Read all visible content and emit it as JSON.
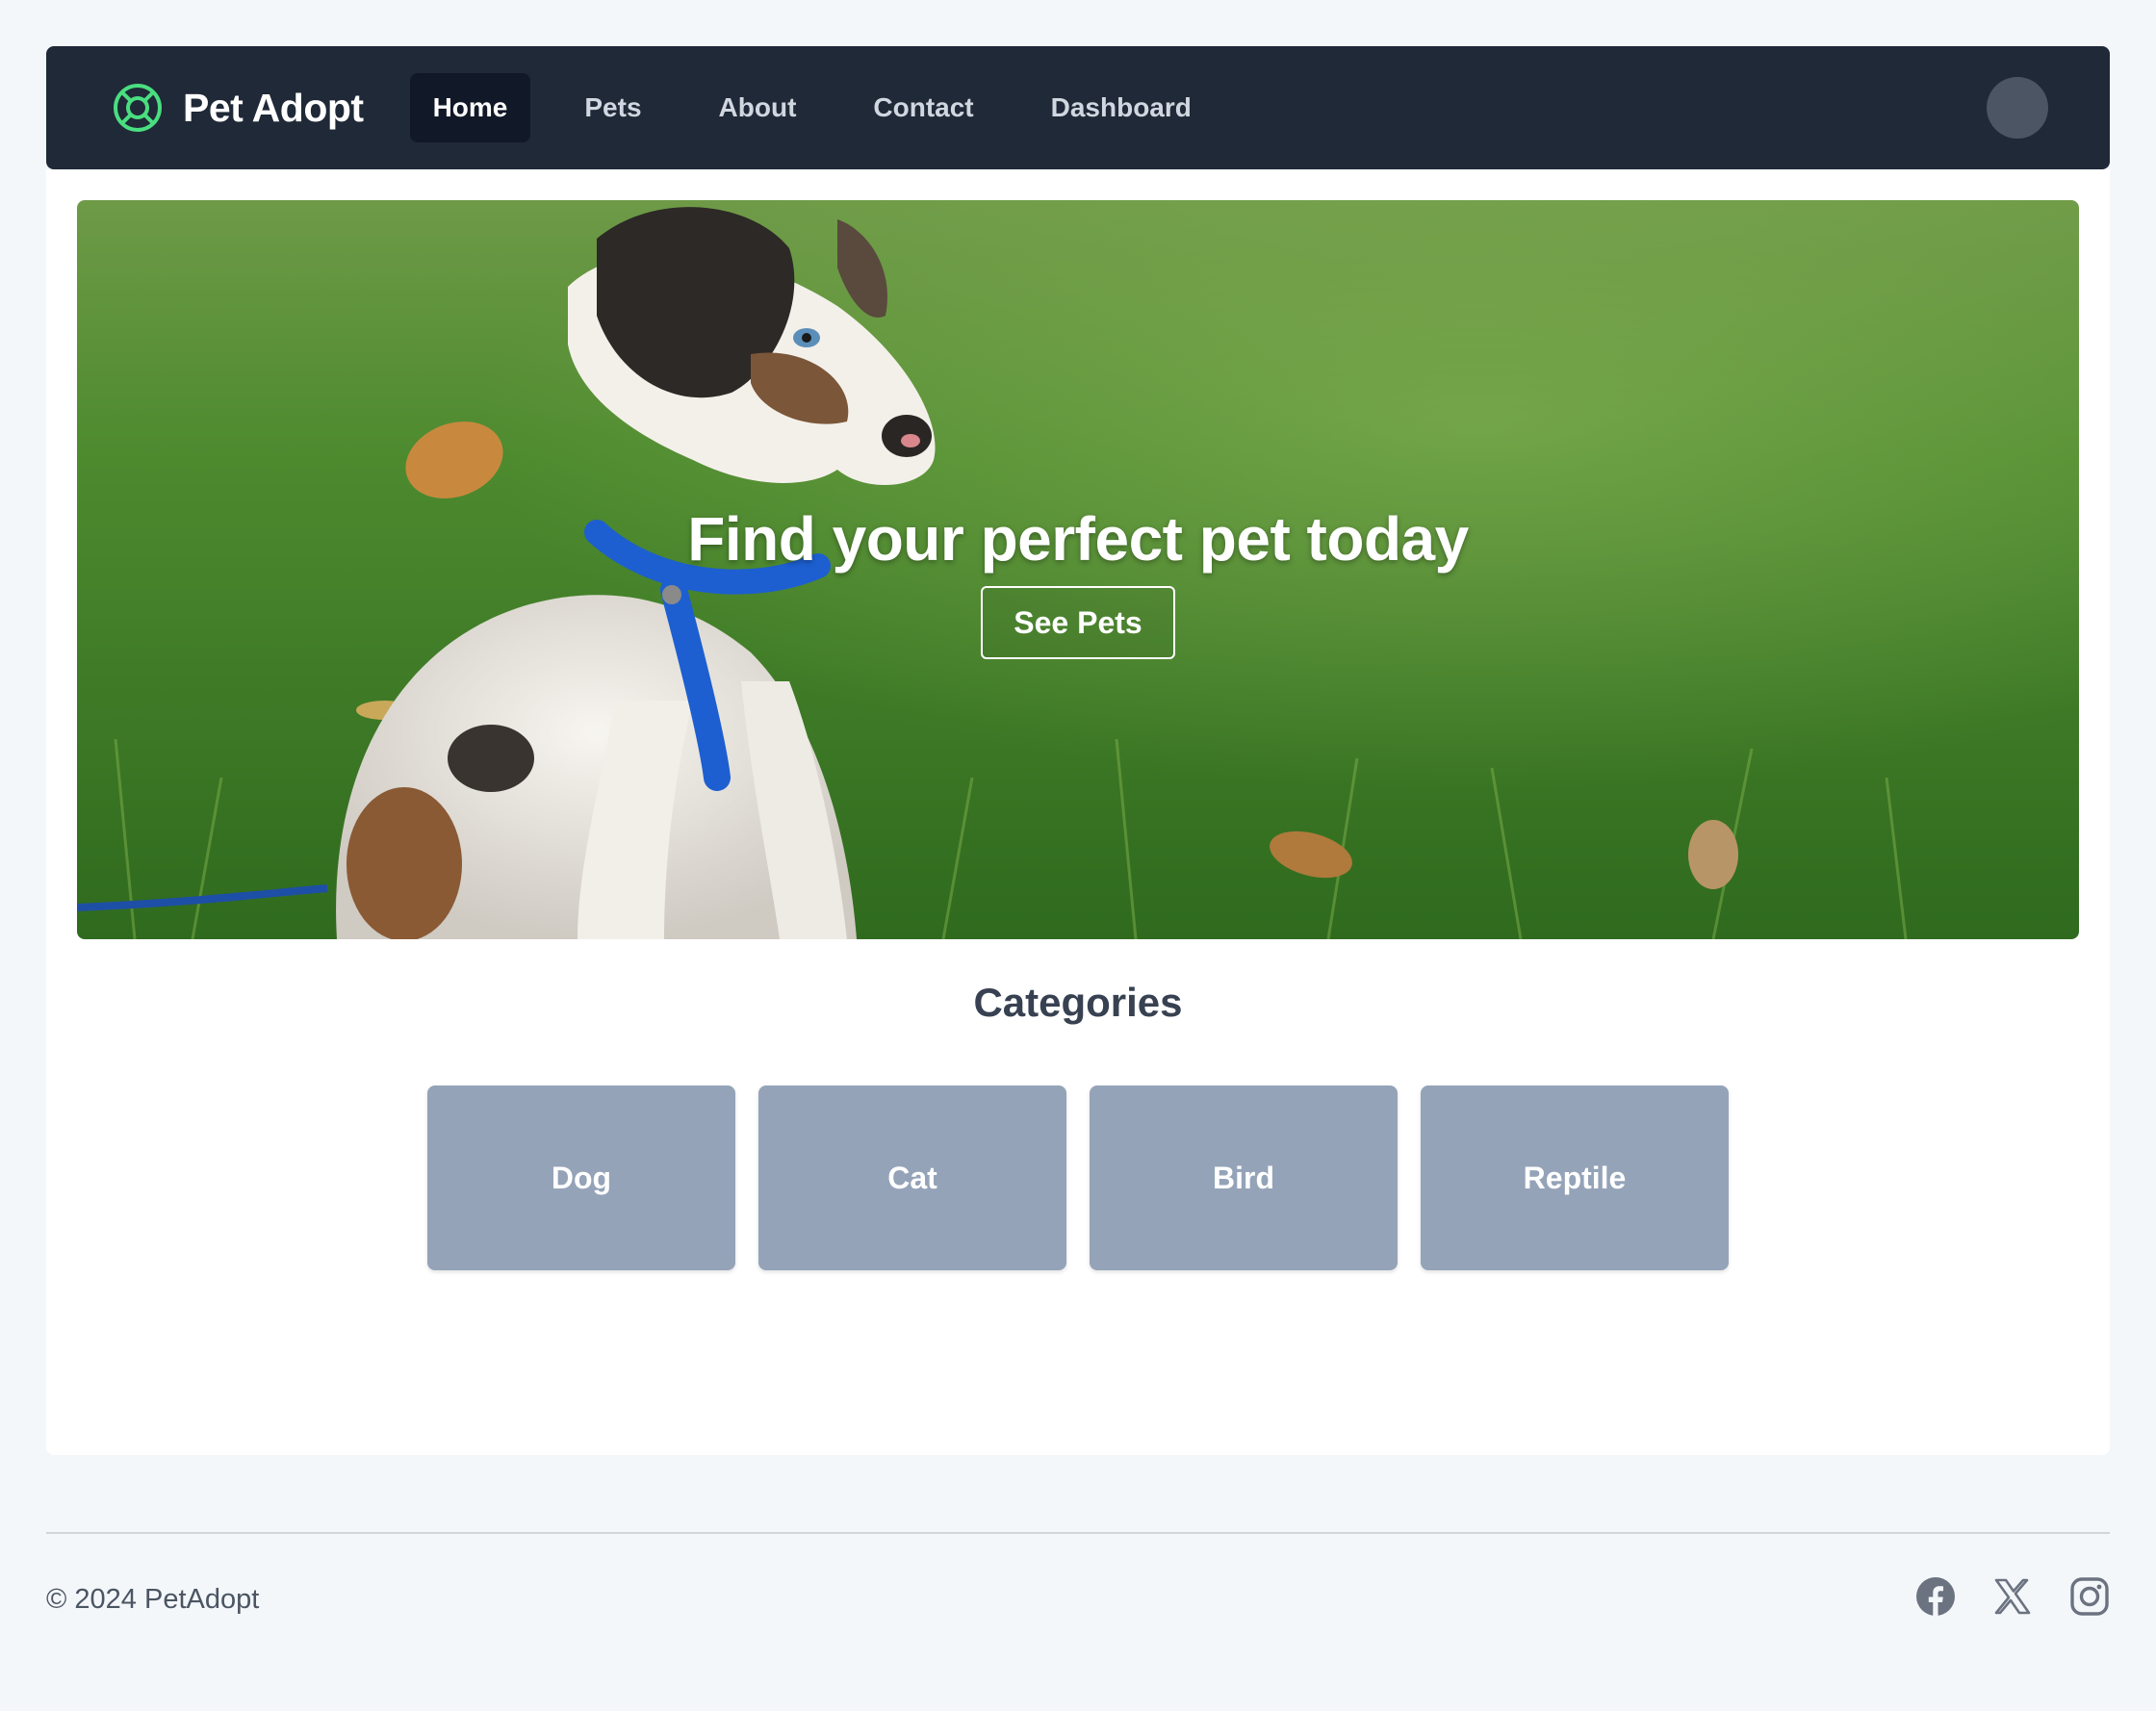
{
  "brand": {
    "name": "Pet Adopt",
    "accent_color": "#4ade80",
    "logo_icon": "lifebuoy-icon"
  },
  "nav": {
    "items": [
      {
        "label": "Home",
        "active": true
      },
      {
        "label": "Pets",
        "active": false
      },
      {
        "label": "About",
        "active": false
      },
      {
        "label": "Contact",
        "active": false
      },
      {
        "label": "Dashboard",
        "active": false
      }
    ],
    "avatar_icon": "user-avatar"
  },
  "hero": {
    "title": "Find your perfect pet today",
    "button_label": "See Pets",
    "image": "puppy-on-grass"
  },
  "categories": {
    "title": "Categories",
    "items": [
      "Dog",
      "Cat",
      "Bird",
      "Reptile"
    ]
  },
  "footer": {
    "copyright": "© 2024 PetAdopt",
    "social": [
      "facebook-icon",
      "x-icon",
      "instagram-icon"
    ]
  },
  "colors": {
    "nav_bg": "#1f2937",
    "nav_active_bg": "#111827",
    "page_bg": "#f4f7fa",
    "category_card": "#94a3b8",
    "heading_text": "#374151",
    "footer_text": "#4b5563"
  }
}
